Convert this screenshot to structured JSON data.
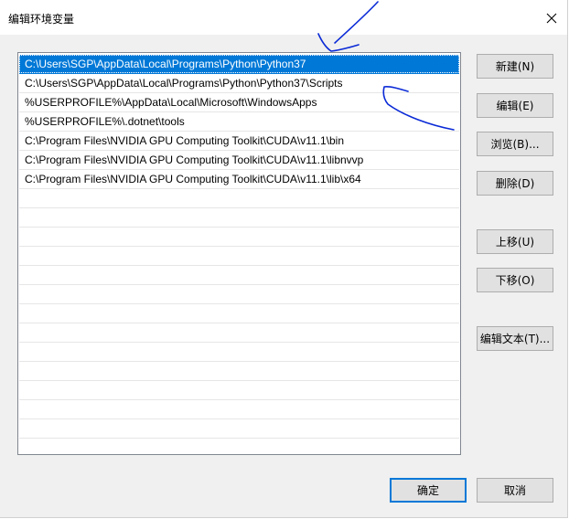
{
  "window": {
    "title": "编辑环境变量"
  },
  "paths": [
    "C:\\Users\\SGP\\AppData\\Local\\Programs\\Python\\Python37",
    "C:\\Users\\SGP\\AppData\\Local\\Programs\\Python\\Python37\\Scripts",
    "%USERPROFILE%\\AppData\\Local\\Microsoft\\WindowsApps",
    "%USERPROFILE%\\.dotnet\\tools",
    "C:\\Program Files\\NVIDIA GPU Computing Toolkit\\CUDA\\v11.1\\bin",
    "C:\\Program Files\\NVIDIA GPU Computing Toolkit\\CUDA\\v11.1\\libnvvp",
    "C:\\Program Files\\NVIDIA GPU Computing Toolkit\\CUDA\\v11.1\\lib\\x64"
  ],
  "selected_index": 0,
  "buttons": {
    "new": "新建(N)",
    "edit": "编辑(E)",
    "browse": "浏览(B)...",
    "delete": "删除(D)",
    "move_up": "上移(U)",
    "move_down": "下移(O)",
    "edit_text": "编辑文本(T)...",
    "ok": "确定",
    "cancel": "取消"
  },
  "colors": {
    "selection": "#0078d7",
    "annotation_ink": "#0a2ad6"
  },
  "icons": {
    "close": "close-icon"
  }
}
